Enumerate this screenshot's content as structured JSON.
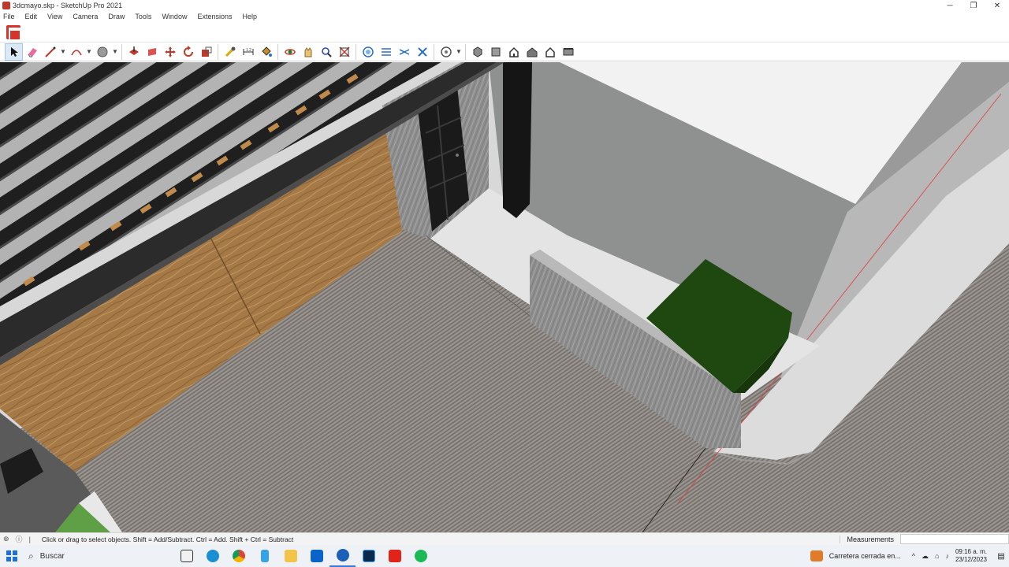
{
  "window": {
    "title": "3dcmayo.skp - SketchUp Pro 2021",
    "minimize": "─",
    "maximize": "❐",
    "close": "✕"
  },
  "menu": [
    "File",
    "Edit",
    "View",
    "Camera",
    "Draw",
    "Tools",
    "Window",
    "Extensions",
    "Help"
  ],
  "toolbar_icons": [
    "select-icon",
    "eraser-icon",
    "line-icon",
    "arc-icon",
    "shapes-icon",
    "push-pull-icon",
    "follow-me-icon",
    "move-icon",
    "rotate-icon",
    "scale-icon",
    "tape-measure-icon",
    "dimension-icon",
    "paint-bucket-icon",
    "orbit-icon",
    "pan-icon",
    "zoom-icon",
    "zoom-extents-icon",
    "xray-icon",
    "section-icon",
    "display-section-icon",
    "display-cuts-icon",
    "styles-icon",
    "iso-view-icon",
    "top-view-icon",
    "front-view-icon",
    "right-view-icon",
    "back-view-icon",
    "left-view-icon"
  ],
  "status": {
    "hint": "Click or drag to select objects. Shift = Add/Subtract. Ctrl = Add. Shift + Ctrl = Subtract",
    "measurements_label": "Measurements",
    "measurements_value": ""
  },
  "taskbar": {
    "search_label": "Buscar",
    "weather_text": "Carretera cerrada en...",
    "time": "09:16 a. m.",
    "date": "23/12/2023",
    "apps": [
      "explorer-app",
      "task-view",
      "edge-app",
      "chrome-app",
      "app-3",
      "files-app",
      "mail-app",
      "sketchup-app",
      "photoshop-app",
      "acrobat-app",
      "spotify-app"
    ]
  },
  "colors": {
    "accent": "#1e6fd9",
    "sketchup_red": "#d6332a",
    "green_block": "#1f4710",
    "wood": "#a67a46"
  }
}
